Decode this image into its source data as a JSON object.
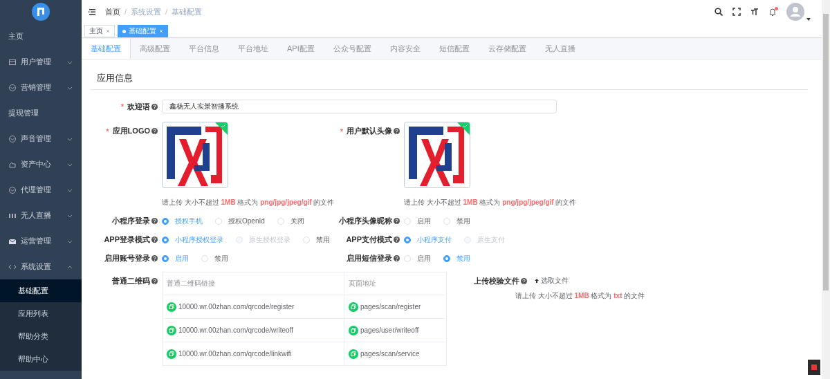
{
  "sidebar": {
    "items": [
      {
        "label": "主页",
        "kind": "plain",
        "selected": false
      },
      {
        "label": "用户管理",
        "kind": "group",
        "expanded": false
      },
      {
        "label": "营销管理",
        "kind": "group",
        "expanded": false
      },
      {
        "label": "提现管理",
        "kind": "plain",
        "selected": false
      },
      {
        "label": "声音管理",
        "kind": "group",
        "expanded": false
      },
      {
        "label": "资产中心",
        "kind": "group",
        "expanded": false
      },
      {
        "label": "代理管理",
        "kind": "group",
        "expanded": false
      },
      {
        "label": "无人直播",
        "kind": "group",
        "expanded": false
      },
      {
        "label": "运营管理",
        "kind": "group",
        "expanded": false
      },
      {
        "label": "系统设置",
        "kind": "group",
        "expanded": true,
        "children": [
          {
            "label": "基础配置",
            "selected": true
          },
          {
            "label": "应用列表",
            "selected": false
          },
          {
            "label": "帮助分类",
            "selected": false
          },
          {
            "label": "帮助中心",
            "selected": false
          }
        ]
      }
    ]
  },
  "header": {
    "breadcrumb": [
      "首页",
      "系统设置",
      "基础配置"
    ],
    "breadcrumb_separator": "/",
    "notification_dot": true
  },
  "tags": [
    {
      "label": "主页",
      "selected": false
    },
    {
      "label": "基础配置",
      "selected": true
    }
  ],
  "tabs": [
    {
      "label": "基础配置",
      "selected": true
    },
    {
      "label": "高级配置",
      "selected": false
    },
    {
      "label": "平台信息",
      "selected": false
    },
    {
      "label": "平台地址",
      "selected": false
    },
    {
      "label": "API配置",
      "selected": false
    },
    {
      "label": "公众号配置",
      "selected": false
    },
    {
      "label": "内容安全",
      "selected": false
    },
    {
      "label": "短信配置",
      "selected": false
    },
    {
      "label": "云存储配置",
      "selected": false
    },
    {
      "label": "无人直播",
      "selected": false
    }
  ],
  "section_title": "应用信息",
  "welcome": {
    "marker": "*",
    "label": "欢迎语",
    "value": "鑫杨无人实景智播系统"
  },
  "uploads": [
    {
      "marker": "*",
      "label": "应用LOGO",
      "uploaded": true,
      "hint": "请上传 大小不超过 **1MB** 格式为 **png/jpg/jpeg/gif** 的文件"
    },
    {
      "marker": "*",
      "label": "用户默认头像",
      "uploaded": true,
      "hint": "请上传 大小不超过 **1MB** 格式为 **png/jpg/jpeg/gif** 的文件"
    }
  ],
  "radio_rows": [
    [
      {
        "label": "小程序登录",
        "options": [
          {
            "label": "授权手机",
            "selected": true,
            "disabled": false
          },
          {
            "label": "授权OpenId",
            "selected": false,
            "disabled": false
          },
          {
            "label": "关闭",
            "selected": false,
            "disabled": false
          }
        ]
      },
      {
        "label": "小程序头像昵称",
        "options": [
          {
            "label": "启用",
            "selected": false,
            "disabled": false
          },
          {
            "label": "禁用",
            "selected": false,
            "disabled": false
          }
        ]
      }
    ],
    [
      {
        "label": "APP登录模式",
        "options": [
          {
            "label": "小程序授权登录",
            "selected": true,
            "disabled": false
          },
          {
            "label": "原生授权登录",
            "selected": false,
            "disabled": true
          },
          {
            "label": "禁用",
            "selected": false,
            "disabled": false
          }
        ]
      },
      {
        "label": "APP支付模式",
        "options": [
          {
            "label": "小程序支付",
            "selected": true,
            "disabled": false
          },
          {
            "label": "原生支付",
            "selected": false,
            "disabled": true
          }
        ]
      }
    ],
    [
      {
        "label": "启用账号登录",
        "options": [
          {
            "label": "启用",
            "selected": true,
            "disabled": false
          },
          {
            "label": "禁用",
            "selected": false,
            "disabled": false
          }
        ]
      },
      {
        "label": "启用短信登录",
        "options": [
          {
            "label": "启用",
            "selected": false,
            "disabled": false
          },
          {
            "label": "禁用",
            "selected": true,
            "disabled": false
          }
        ]
      }
    ]
  ],
  "qr_table": {
    "label": "普通二维码",
    "columns": [
      "普通二维码链接",
      "页面地址"
    ],
    "rows": [
      [
        "10000.wr.00zhan.com/qrcode/register",
        "pages/scan/register"
      ],
      [
        "10000.wr.00zhan.com/qrcode/writeoff",
        "pages/user/writeoff"
      ],
      [
        "10000.wr.00zhan.com/qrcode/linkwifi",
        "pages/scan/service"
      ]
    ]
  },
  "verify_file": {
    "label": "上传校验文件",
    "button": "选取文件",
    "hint": "请上传 大小不超过 **1MB** 格式为 **txt** 的文件"
  }
}
